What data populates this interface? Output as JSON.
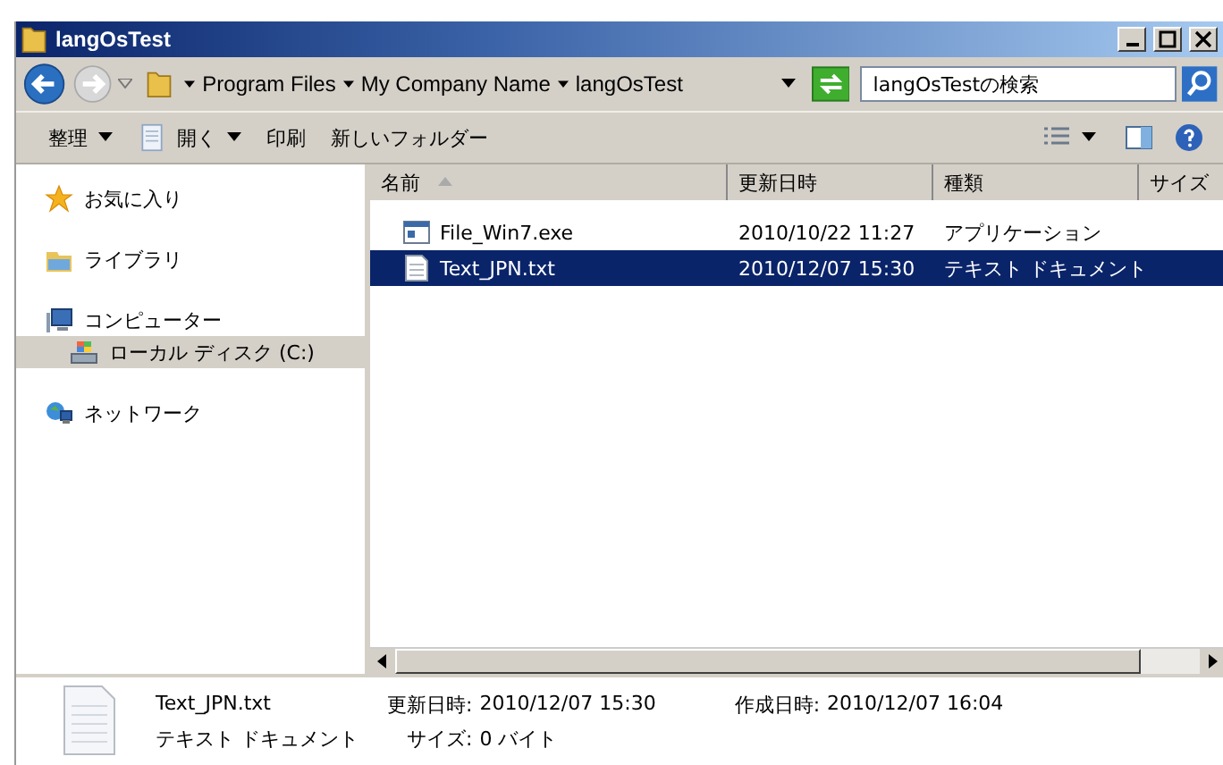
{
  "window": {
    "title": "langOsTest"
  },
  "address": {
    "segments": [
      "Program Files",
      "My Company Name",
      "langOsTest"
    ]
  },
  "search": {
    "placeholder": "langOsTestの検索"
  },
  "toolbar": [
    {
      "label": "整理",
      "kind": "menu"
    },
    {
      "label": "開く",
      "kind": "open"
    },
    {
      "label": "印刷",
      "kind": "plain"
    },
    {
      "label": "新しいフォルダー",
      "kind": "plain"
    }
  ],
  "nav": [
    {
      "label": "お気に入り",
      "kind": "star",
      "selected": false
    },
    {
      "label": "ライブラリ",
      "kind": "library",
      "selected": false
    },
    {
      "label": "コンピューター",
      "kind": "computer",
      "selected": false,
      "children": [
        {
          "label": "ローカル ディスク (C:)",
          "kind": "disk",
          "selected": true
        }
      ]
    },
    {
      "label": "ネットワーク",
      "kind": "network",
      "selected": false
    }
  ],
  "columns": [
    {
      "label": "名前",
      "sorted": true
    },
    {
      "label": "更新日時",
      "sorted": false
    },
    {
      "label": "種類",
      "sorted": false
    },
    {
      "label": "サイズ",
      "sorted": false
    }
  ],
  "files": [
    {
      "name": "File_Win7.exe",
      "modified": "2010/10/22 11:27",
      "type": "アプリケーション",
      "kind": "exe",
      "selected": false
    },
    {
      "name": "Text_JPN.txt",
      "modified": "2010/12/07 15:30",
      "type": "テキスト ドキュメント",
      "kind": "txt",
      "selected": true
    }
  ],
  "details": {
    "name": "Text_JPN.txt",
    "type": "テキスト ドキュメント",
    "fields": [
      {
        "label": "更新日時:",
        "value": "2010/12/07 15:30"
      },
      {
        "label": "作成日時:",
        "value": "2010/12/07 16:04"
      },
      {
        "label": "サイズ:",
        "value": "0 バイト"
      }
    ]
  }
}
